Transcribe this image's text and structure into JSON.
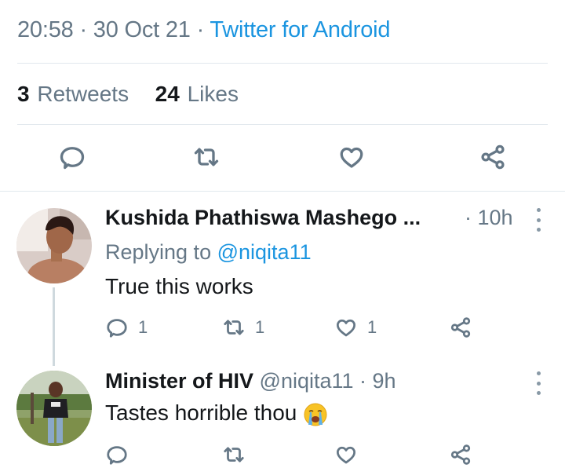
{
  "tweet_meta": {
    "time": "20:58",
    "dot1": "·",
    "date": "30 Oct 21",
    "dot2": "·",
    "source": "Twitter for Android"
  },
  "stats": {
    "retweets_count": "3",
    "retweets_label": "Retweets",
    "likes_count": "24",
    "likes_label": "Likes"
  },
  "actions": [
    "reply-icon",
    "retweet-icon",
    "like-icon",
    "share-icon"
  ],
  "replies": [
    {
      "name": "Kushida Phathiswa Mashego ...",
      "time": "· 10h",
      "replying_prefix": "Replying to",
      "replying_handle": "@niqita11",
      "text": "True this works",
      "reply_count": "1",
      "retweet_count": "1",
      "like_count": "1"
    },
    {
      "name": "Minister of HIV",
      "handle": "@niqita11 · 9h",
      "text": "Tastes horrible thou",
      "emoji": "loudly-crying-face",
      "reply_count": "",
      "retweet_count": "",
      "like_count": ""
    }
  ],
  "colors": {
    "accent": "#1b95e0",
    "muted": "#657786",
    "divider": "#e1e8ed"
  }
}
